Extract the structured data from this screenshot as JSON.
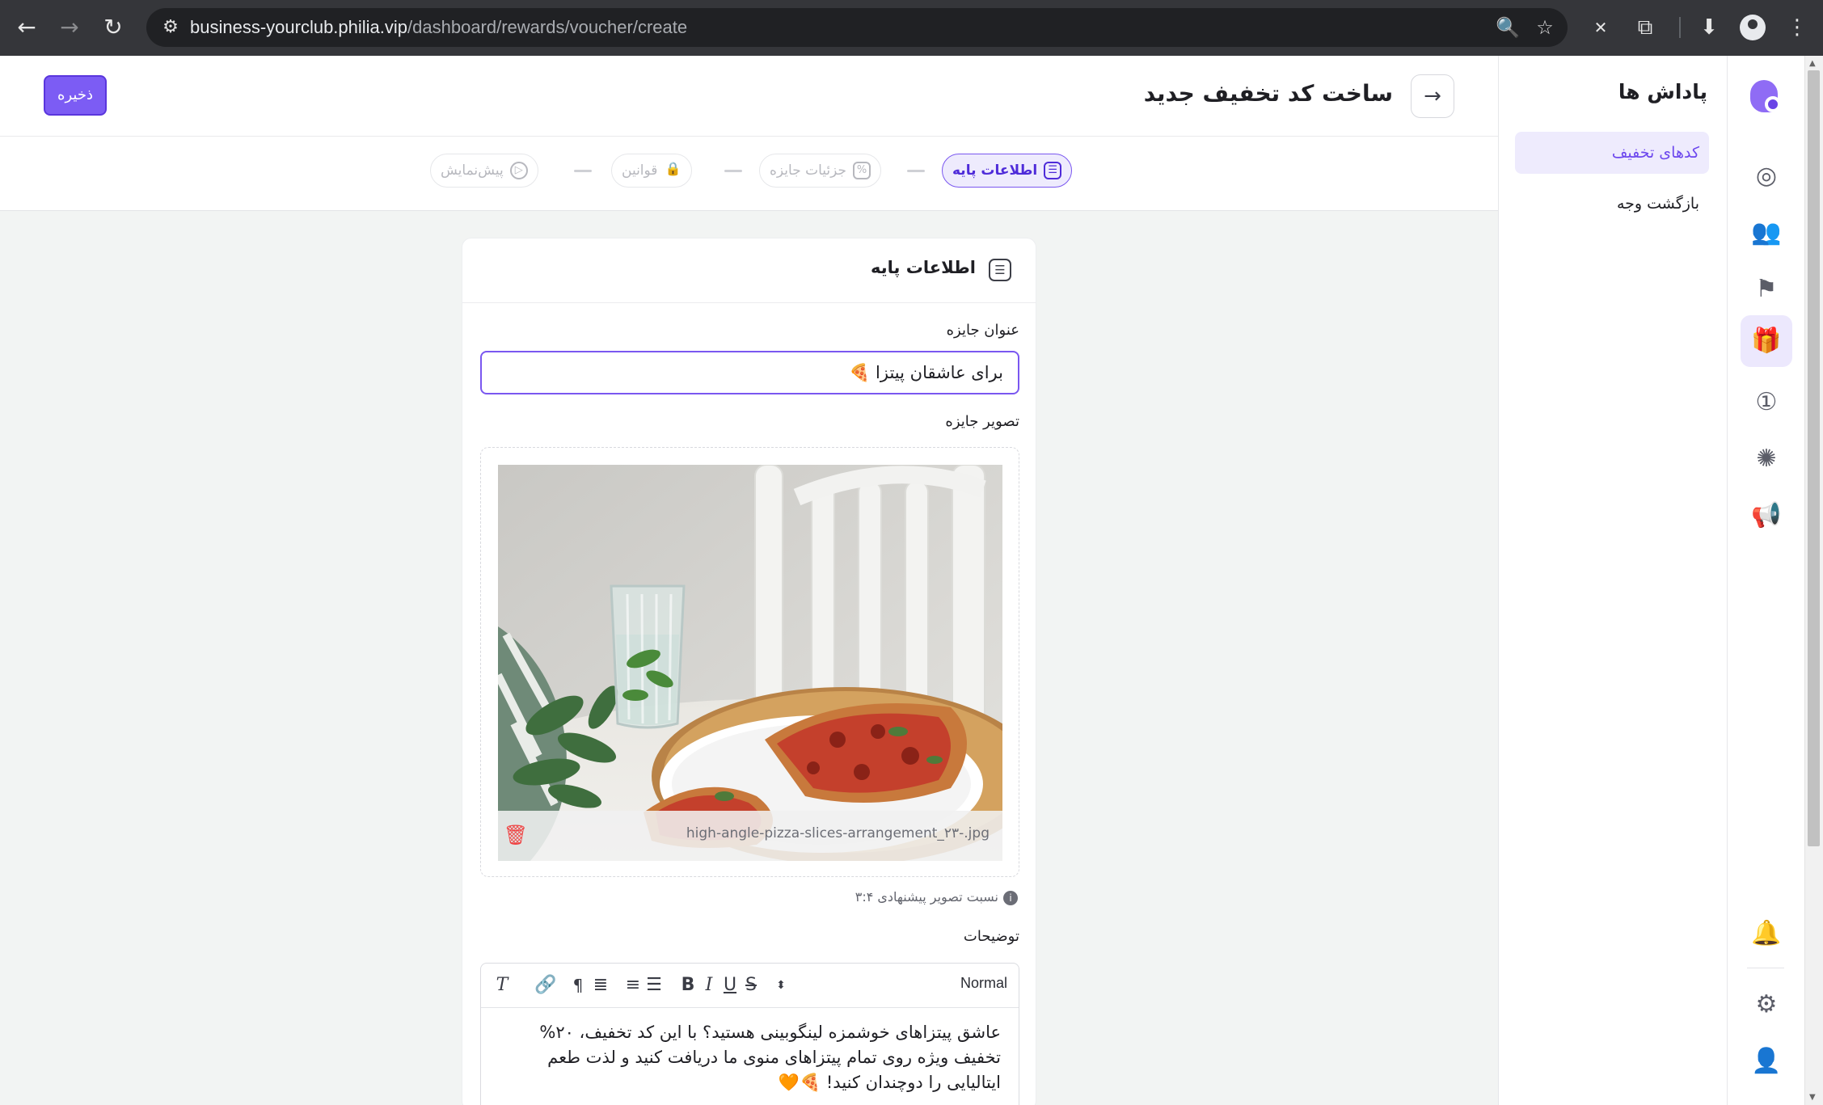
{
  "browser": {
    "url_host": "business-yourclub.philia.vip",
    "url_path": "/dashboard/rewards/voucher/create"
  },
  "icons": {
    "back": "←",
    "forward": "→",
    "reload": "↻",
    "tune": "⚙",
    "zoom": "🔍",
    "star": "☆",
    "close": "✕",
    "extensions": "⧉",
    "download": "⬇",
    "menu": "⋮"
  },
  "rail": {
    "items": [
      {
        "name": "rail-analytics-icon",
        "glyph": "◎"
      },
      {
        "name": "rail-users-icon",
        "glyph": "👥"
      },
      {
        "name": "rail-flag-icon",
        "glyph": "⚑"
      },
      {
        "name": "rail-gift-icon",
        "glyph": "🎁"
      },
      {
        "name": "rail-coin-icon",
        "glyph": "①"
      },
      {
        "name": "rail-wheel-icon",
        "glyph": "✺"
      },
      {
        "name": "rail-megaphone-icon",
        "glyph": "📢"
      }
    ],
    "bell": "🔔",
    "settings": "⚙",
    "profile": "👤"
  },
  "sidebar": {
    "title": "پاداش ها",
    "items": [
      {
        "label": "کدهای تخفیف",
        "active": true
      },
      {
        "label": "بازگشت وجه",
        "active": false
      }
    ]
  },
  "header": {
    "title": "ساخت کد تخفیف جدید",
    "save_label": "ذخیره",
    "back_glyph": "→"
  },
  "steps": [
    {
      "label": "اطلاعات پایه",
      "glyph": "☰",
      "active": true
    },
    {
      "label": "جزئیات جایزه",
      "glyph": "%",
      "active": false
    },
    {
      "label": "قوانین",
      "glyph": "🔒",
      "active": false
    },
    {
      "label": "پیش‌نمایش",
      "glyph": "▷",
      "active": false
    }
  ],
  "form": {
    "section_title": "اطلاعات پایه",
    "title_label": "عنوان جایزه",
    "title_value": "برای عاشقان پیتزا 🍕",
    "image_label": "تصویر جایزه",
    "image_filename": "high-angle-pizza-slices-arrangement_۲۳-.jpg",
    "image_hint": "نسبت تصویر پیشنهادی ۳:۴",
    "description_label": "توضیحات",
    "editor_style": "Normal",
    "description_value": "عاشق پیتزاهای خوشمزه لینگوبینی هستید؟ با این کد تخفیف، ۲۰% تخفیف ویژه روی تمام پیتزاهای منوی ما دریافت کنید و لذت طعم ایتالیایی را دوچندان کنید! 🍕🧡"
  },
  "colors": {
    "accent": "#7a57f0",
    "accent_light": "#eeebfd",
    "danger": "#ef4444"
  }
}
